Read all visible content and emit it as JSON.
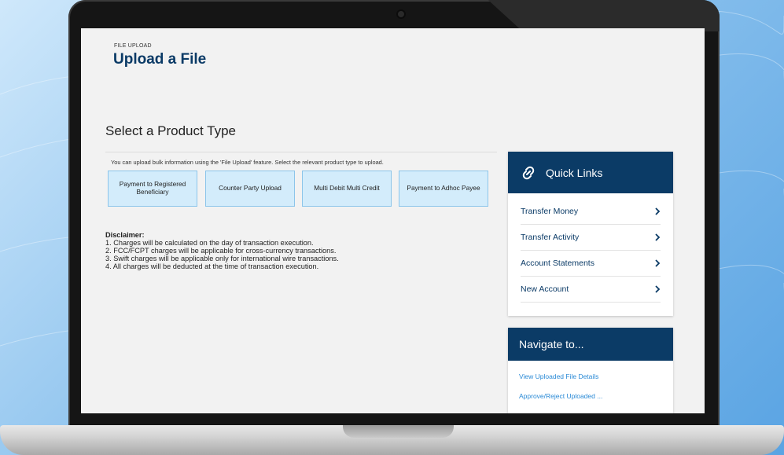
{
  "page": {
    "eyebrow": "FILE UPLOAD",
    "title": "Upload a File"
  },
  "product_section": {
    "title": "Select a Product Type",
    "intro": "You can upload bulk information using the 'File Upload' feature. Select the relevant product type to upload.",
    "buttons": [
      {
        "label": "Payment to Registered Beneficiary"
      },
      {
        "label": "Counter Party Upload"
      },
      {
        "label": "Multi Debit Multi Credit"
      },
      {
        "label": "Payment to Adhoc Payee"
      }
    ]
  },
  "disclaimer": {
    "heading": "Disclaimer:",
    "lines": [
      "1. Charges will be calculated on the day of transaction execution.",
      "2. FCC/FCPT charges will be applicable for cross-currency transactions.",
      "3. Swift charges will be applicable only for international wire transactions.",
      "4. All charges will be deducted at the time of transaction execution."
    ]
  },
  "quick_links": {
    "title": "Quick Links",
    "icon": "link-icon",
    "items": [
      {
        "label": "Transfer Money"
      },
      {
        "label": "Transfer Activity"
      },
      {
        "label": "Account Statements"
      },
      {
        "label": "New Account"
      }
    ]
  },
  "navigate": {
    "title": "Navigate to...",
    "links": [
      {
        "label": "View Uploaded File Details"
      },
      {
        "label": "Approve/Reject Uploaded ..."
      }
    ]
  },
  "colors": {
    "brand_navy": "#0b3b66",
    "button_fill": "#d3ecfb",
    "link_blue": "#2a8ad6"
  }
}
